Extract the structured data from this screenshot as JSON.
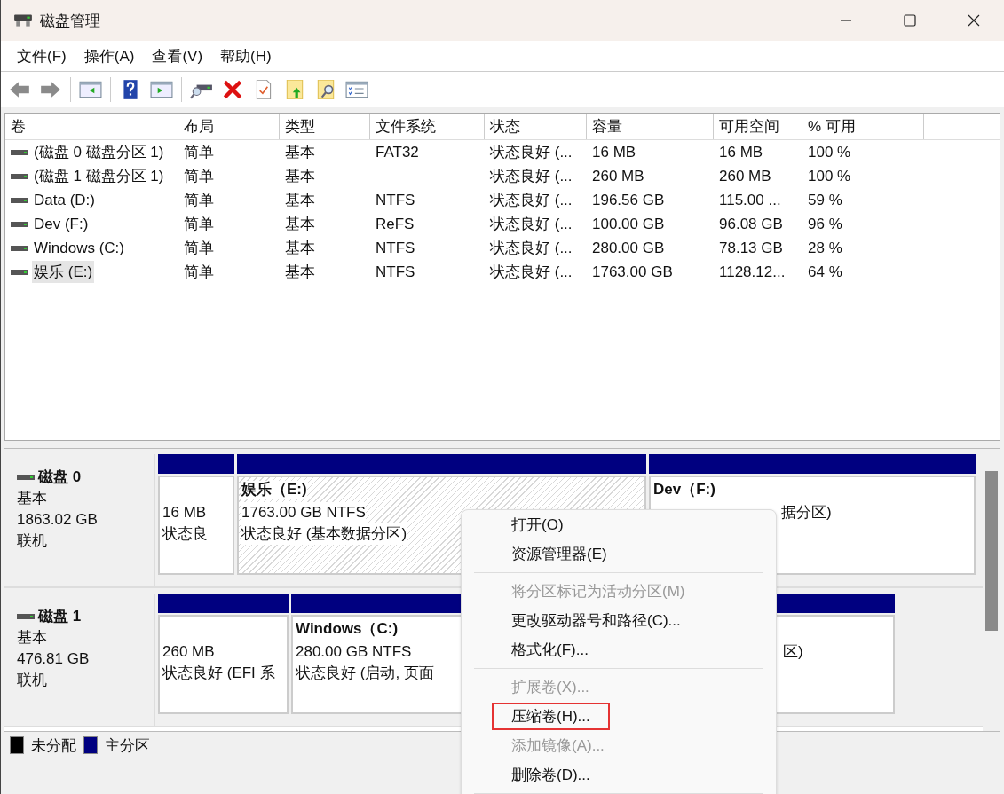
{
  "window": {
    "title": "磁盘管理"
  },
  "menu": [
    "文件(F)",
    "操作(A)",
    "查看(V)",
    "帮助(H)"
  ],
  "toolbar": [
    {
      "kind": "back"
    },
    {
      "kind": "forward"
    },
    {
      "kind": "separator"
    },
    {
      "kind": "panel-left"
    },
    {
      "kind": "separator"
    },
    {
      "kind": "help"
    },
    {
      "kind": "panel-right"
    },
    {
      "kind": "separator"
    },
    {
      "kind": "drive"
    },
    {
      "kind": "delete"
    },
    {
      "kind": "check"
    },
    {
      "kind": "up"
    },
    {
      "kind": "find"
    },
    {
      "kind": "list"
    }
  ],
  "table": {
    "columns": [
      "卷",
      "布局",
      "类型",
      "文件系统",
      "状态",
      "容量",
      "可用空间",
      "% 可用"
    ],
    "rows": [
      {
        "cells": [
          "(磁盘 0 磁盘分区 1)",
          "简单",
          "基本",
          "FAT32",
          "状态良好 (...",
          "16 MB",
          "16 MB",
          "100 %"
        ],
        "selected": false
      },
      {
        "cells": [
          "(磁盘 1 磁盘分区 1)",
          "简单",
          "基本",
          "",
          "状态良好 (...",
          "260 MB",
          "260 MB",
          "100 %"
        ],
        "selected": false
      },
      {
        "cells": [
          "Data (D:)",
          "简单",
          "基本",
          "NTFS",
          "状态良好 (...",
          "196.56 GB",
          "115.00 ...",
          "59 %"
        ],
        "selected": false
      },
      {
        "cells": [
          "Dev (F:)",
          "简单",
          "基本",
          "ReFS",
          "状态良好 (...",
          "100.00 GB",
          "96.08 GB",
          "96 %"
        ],
        "selected": false
      },
      {
        "cells": [
          "Windows (C:)",
          "简单",
          "基本",
          "NTFS",
          "状态良好 (...",
          "280.00 GB",
          "78.13 GB",
          "28 %"
        ],
        "selected": false
      },
      {
        "cells": [
          "娱乐 (E:)",
          "简单",
          "基本",
          "NTFS",
          "状态良好 (...",
          "1763.00 GB",
          "1128.12...",
          "64 %"
        ],
        "selected": true
      }
    ]
  },
  "disks": [
    {
      "name": "磁盘 0",
      "type": "基本",
      "size": "1863.02 GB",
      "status": "联机",
      "partitions": [
        {
          "lines": [
            "16 MB",
            "状态良"
          ],
          "selected": false
        },
        {
          "title": "娱乐（E:)",
          "lines": [
            "1763.00 GB NTFS",
            "状态良好 (基本数据分区)"
          ],
          "selected": true
        },
        {
          "title": "Dev（F:)",
          "lines": [
            "据分区)"
          ],
          "selected": false
        }
      ]
    },
    {
      "name": "磁盘 1",
      "type": "基本",
      "size": "476.81 GB",
      "status": "联机",
      "partitions": [
        {
          "lines": [
            "260 MB",
            "状态良好 (EFI 系"
          ],
          "selected": false
        },
        {
          "title": "Windows（C:)",
          "lines": [
            "280.00 GB NTFS",
            "状态良好 (启动, 页面"
          ],
          "selected": false
        },
        {
          "lines": [
            "区)"
          ],
          "selected": false
        }
      ]
    }
  ],
  "legend": [
    {
      "label": "未分配",
      "color": "#000000"
    },
    {
      "label": "主分区",
      "color": "#000080"
    }
  ],
  "context_menu": [
    {
      "kind": "item",
      "label": "打开(O)",
      "disabled": false,
      "boxed": false
    },
    {
      "kind": "item",
      "label": "资源管理器(E)",
      "disabled": false,
      "boxed": false
    },
    {
      "kind": "separator"
    },
    {
      "kind": "item",
      "label": "将分区标记为活动分区(M)",
      "disabled": true,
      "boxed": false
    },
    {
      "kind": "item",
      "label": "更改驱动器号和路径(C)...",
      "disabled": false,
      "boxed": false
    },
    {
      "kind": "item",
      "label": "格式化(F)...",
      "disabled": false,
      "boxed": false
    },
    {
      "kind": "separator"
    },
    {
      "kind": "item",
      "label": "扩展卷(X)...",
      "disabled": true,
      "boxed": false
    },
    {
      "kind": "item",
      "label": "压缩卷(H)...",
      "disabled": false,
      "boxed": true
    },
    {
      "kind": "item",
      "label": "添加镜像(A)...",
      "disabled": true,
      "boxed": false
    },
    {
      "kind": "item",
      "label": "删除卷(D)...",
      "disabled": false,
      "boxed": false
    },
    {
      "kind": "separator"
    }
  ]
}
